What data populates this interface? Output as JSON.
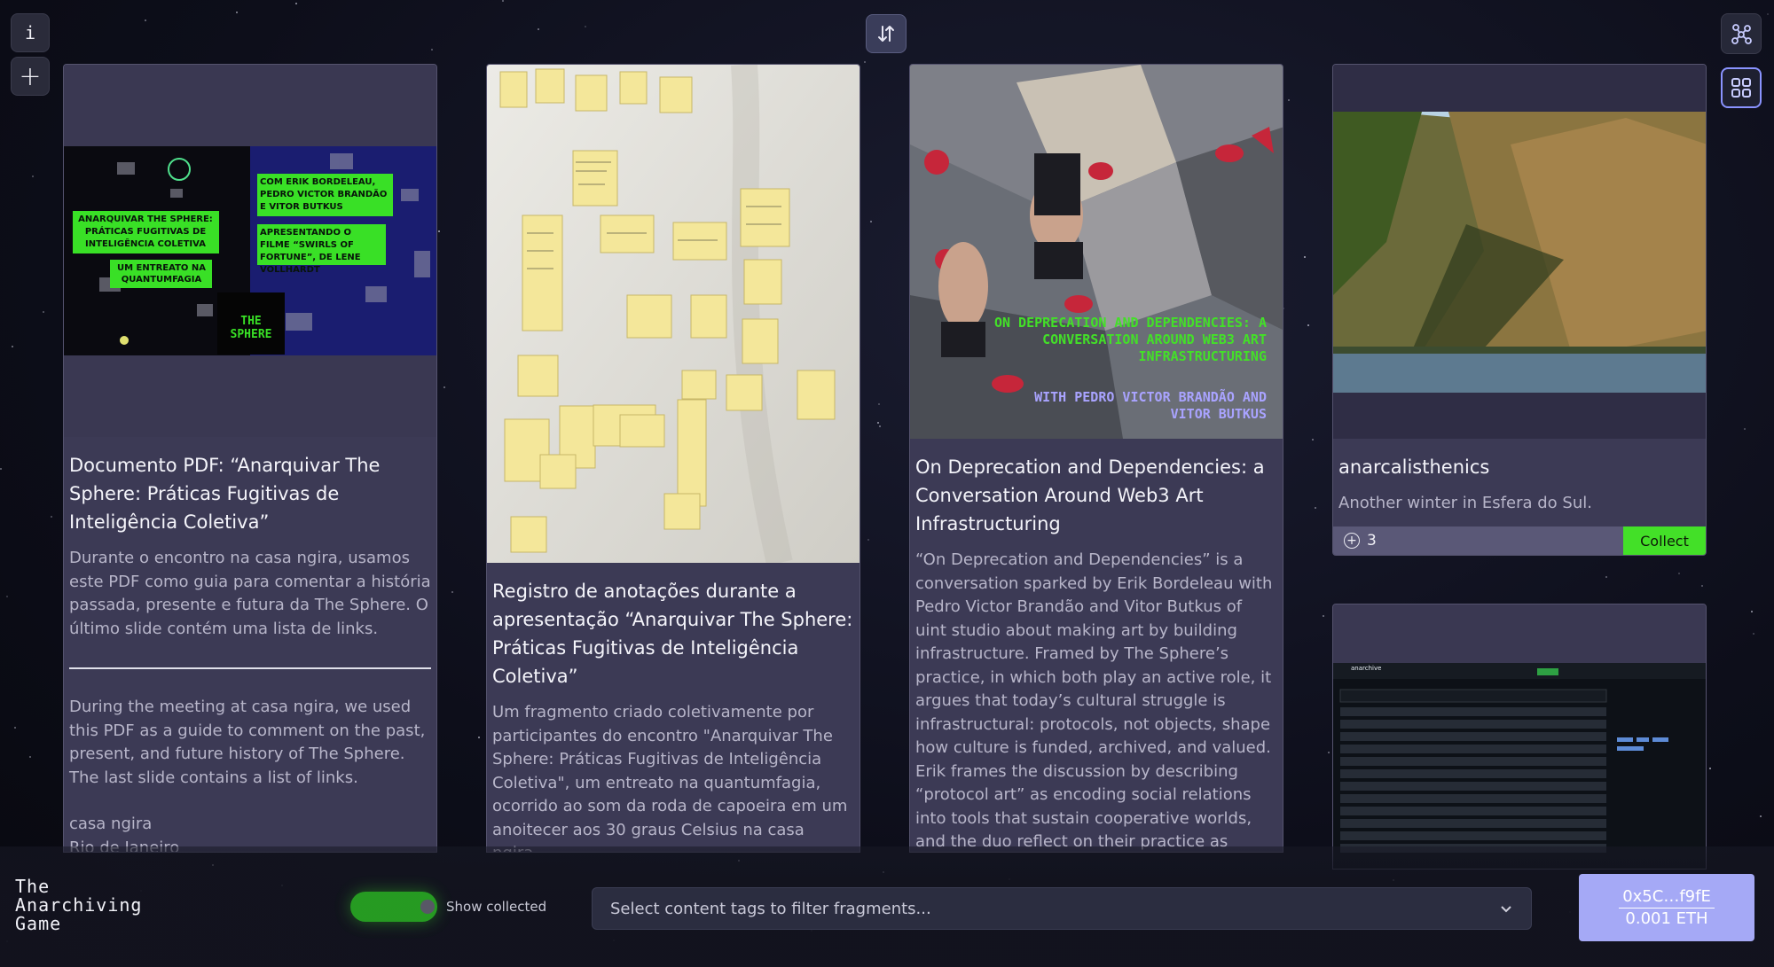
{
  "app": {
    "title_lines": [
      "The",
      "Anarchiving",
      "Game"
    ]
  },
  "toolbar": {
    "info_label": "i",
    "add_label": "+"
  },
  "cards": [
    {
      "title": "Documento PDF: “Anarquivar The Sphere: Práticas Fugitivas de Inteligência Coletiva”",
      "desc_pt": "Durante o encontro na casa ngira, usamos este PDF como guia para comentar a história passada, presente e futura da The Sphere. O último slide contém uma lista de links.",
      "desc_en": "During the meeting at casa ngira, we used this PDF as a guide to comment on the past, present, and future history of The Sphere. The last slide contains a list of links.",
      "place": "casa ngira",
      "city": "Rio de Janeiro",
      "image": {
        "left_text_1": "ANARQUIVAR THE SPHERE: PRÁTICAS FUGITIVAS DE INTELIGÊNCIA COLETIVA",
        "left_text_2": "UM ENTREATO NA QUANTUMFAGIA",
        "right_text_1": "COM ERIK BORDELEAU, PEDRO VICTOR BRANDÃO E VITOR BUTKUS",
        "right_text_2": "APRESENTANDO O FILME “SWIRLS OF FORTUNE”, DE LENE VOLLHARDT",
        "logo": "THE SPHERE"
      }
    },
    {
      "title": "Registro de anotações durante a apresentação “Anarquivar The Sphere: Práticas Fugitivas de Inteligência Coletiva”",
      "desc": "Um fragmento criado coletivamente por participantes do encontro \"Anarquivar The Sphere: Práticas Fugitivas de Inteligência Coletiva\", um entreato na quantumfagia, ocorrido ao som da roda de capoeira em um anoitecer aos 30 graus Celsius na casa ngira."
    },
    {
      "title": "On Deprecation and Dependencies: a Conversation Around Web3 Art Infrastructuring",
      "desc": "“On Deprecation and Dependencies” is a conversation sparked by Erik Bordeleau with Pedro Victor Brandão and Vitor Butkus of uint studio about making art by building infrastructure. Framed by The Sphere’s practice, in which both play an active role, it argues that today’s cultural struggle is infrastructural: protocols, not objects, shape how culture is funded, archived, and valued. Erik frames the discussion by describing “protocol art” as encoding social relations into tools that sustain cooperative worlds, and the duo reflect on their practice as artist-developers.",
      "image": {
        "green_text": "ON DEPRECATION AND DEPENDENCIES: A CONVERSATION AROUND WEB3 ART INFRASTRUCTURING",
        "purple_text": "WITH PEDRO VICTOR BRANDÃO AND VITOR BUTKUS"
      }
    },
    {
      "title": "anarcalisthenics",
      "desc": "Another winter in Esfera do Sul.",
      "collect_count": "3",
      "collect_label": "Collect"
    },
    {
      "image": {
        "repo_name": "anarchive"
      }
    }
  ],
  "footer": {
    "toggle_label": "Show collected",
    "tag_placeholder": "Select content tags to filter fragments...",
    "wallet_address": "0x5C…f9fE",
    "wallet_balance": "0.001 ETH"
  },
  "colors": {
    "accent_green": "#43e028",
    "wallet_purple": "#a5a9f6",
    "card_bg": "#3c3a55"
  }
}
